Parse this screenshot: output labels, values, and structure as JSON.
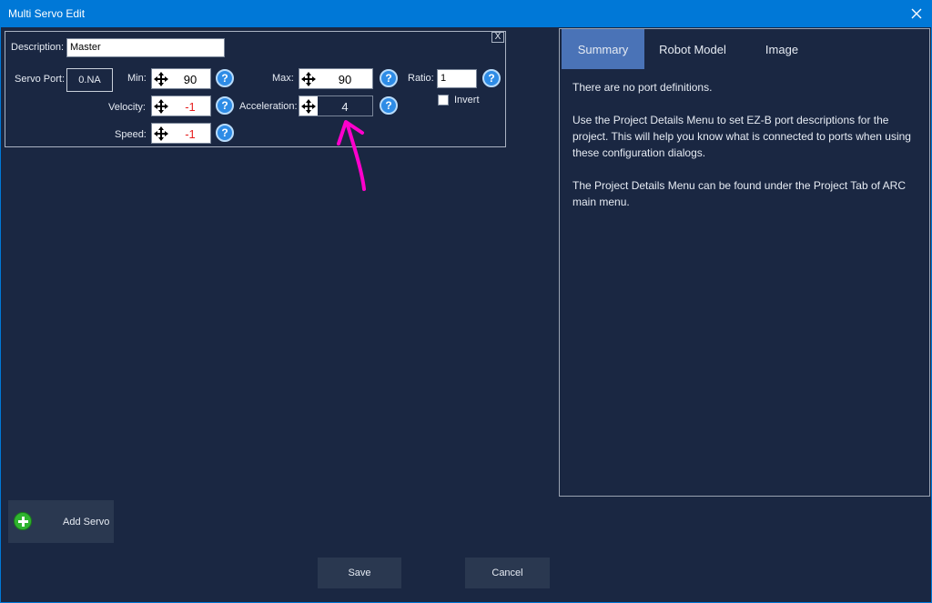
{
  "window": {
    "title": "Multi Servo Edit",
    "close_icon": "close-icon"
  },
  "servo": {
    "close_label": "X",
    "description_label": "Description:",
    "description_value": "Master",
    "servo_port_label": "Servo Port:",
    "servo_port_value": "0.NA",
    "min_label": "Min:",
    "min_value": "90",
    "max_label": "Max:",
    "max_value": "90",
    "ratio_label": "Ratio:",
    "ratio_value": "1",
    "velocity_label": "Velocity:",
    "velocity_value": "-1",
    "acceleration_label": "Acceleration:",
    "acceleration_value": "4",
    "speed_label": "Speed:",
    "speed_value": "-1",
    "invert_label": "Invert",
    "invert_checked": false,
    "help_glyph": "?"
  },
  "tabs": [
    {
      "label": "Summary",
      "active": true
    },
    {
      "label": "Robot Model",
      "active": false
    },
    {
      "label": "Image",
      "active": false
    }
  ],
  "summary": {
    "line1": "There are no port definitions.",
    "line2": "Use the Project Details Menu to set EZ-B port descriptions for the project. This will help you know what is connected to ports when using these configuration dialogs.",
    "line3": "The Project Details Menu can be found under the Project Tab of ARC main menu."
  },
  "actions": {
    "add_servo": "Add Servo",
    "save": "Save",
    "cancel": "Cancel"
  },
  "colors": {
    "titlebar": "#0078d7",
    "background": "#1a2742",
    "active_tab": "#4a73b7",
    "negative_value": "#e61e1e",
    "annotation": "#ff00cc"
  }
}
